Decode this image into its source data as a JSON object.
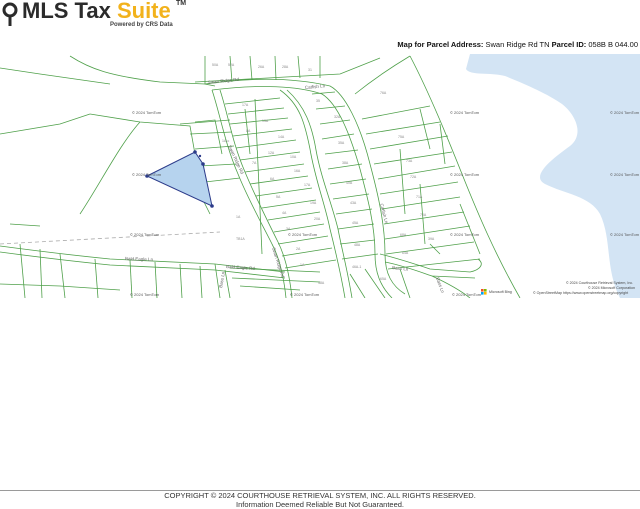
{
  "header": {
    "brand_main": "MLS Tax",
    "brand_accent": "Suite",
    "trademark": "TM",
    "powered_by": "Powered by CRS Data"
  },
  "map_header": {
    "label": "Map for Parcel Address:",
    "address": "Swan Ridge Rd TN",
    "parcel_label": "Parcel ID:",
    "parcel_id": "058B B 044.00"
  },
  "map": {
    "streets": [
      "Swan Ridge Rd",
      "Catfish Ln",
      "Swan Ridge Rd",
      "Catfish Ln",
      "Bald Eagle Ln",
      "Bald Eagle Rd",
      "Bass Ln",
      "Swan Ridge Rd",
      "Bass Ln",
      "Bass Ln"
    ],
    "watermark": "© 2024 TomTom",
    "attribution": [
      "© 2024 Courthouse Retrieval System, Inc.",
      "© 2024 Microsoft Corporation",
      "© OpenStreetMap https://www.openstreetmap.org/copyright"
    ],
    "bing_logo": "Microsoft Bing",
    "colors": {
      "water": "#d3e4f4",
      "parcel_lines": "#4fa04a",
      "selected_fill": "#b6d3ee",
      "selected_stroke": "#2c3b8a"
    }
  },
  "footer": {
    "copyright": "COPYRIGHT © 2024 COURTHOUSE RETRIEVAL SYSTEM, INC. ALL RIGHTS RESERVED.",
    "disclaimer": "Information Deemed Reliable But Not Guaranteed."
  }
}
